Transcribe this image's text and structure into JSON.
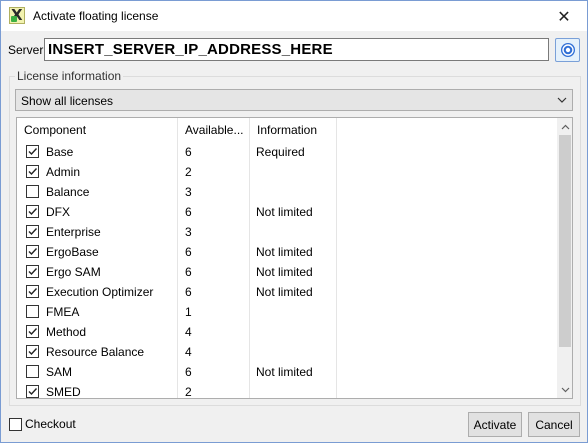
{
  "window": {
    "title": "Activate floating license",
    "close_glyph": "✕"
  },
  "server": {
    "label": "Server",
    "value": "INSERT_SERVER_IP_ADDRESS_HERE",
    "button_icon": "network-icon"
  },
  "license_info": {
    "legend": "License information",
    "filter": {
      "selected": "Show all licenses"
    },
    "table": {
      "headers": [
        "Component",
        "Available...",
        "Information"
      ],
      "rows": [
        {
          "checked": true,
          "component": "Base",
          "available": "6",
          "info": "Required"
        },
        {
          "checked": true,
          "component": "Admin",
          "available": "2",
          "info": ""
        },
        {
          "checked": false,
          "component": "Balance",
          "available": "3",
          "info": ""
        },
        {
          "checked": true,
          "component": "DFX",
          "available": "6",
          "info": "Not limited"
        },
        {
          "checked": true,
          "component": "Enterprise",
          "available": "3",
          "info": ""
        },
        {
          "checked": true,
          "component": "ErgoBase",
          "available": "6",
          "info": "Not limited"
        },
        {
          "checked": true,
          "component": "Ergo SAM",
          "available": "6",
          "info": "Not limited"
        },
        {
          "checked": true,
          "component": "Execution Optimizer",
          "available": "6",
          "info": "Not limited"
        },
        {
          "checked": false,
          "component": "FMEA",
          "available": "1",
          "info": ""
        },
        {
          "checked": true,
          "component": "Method",
          "available": "4",
          "info": ""
        },
        {
          "checked": true,
          "component": "Resource Balance",
          "available": "4",
          "info": ""
        },
        {
          "checked": false,
          "component": "SAM",
          "available": "6",
          "info": "Not limited"
        },
        {
          "checked": true,
          "component": "SMED",
          "available": "2",
          "info": ""
        }
      ]
    }
  },
  "footer": {
    "checkout": {
      "label": "Checkout",
      "checked": false
    },
    "activate_label": "Activate",
    "cancel_label": "Cancel"
  },
  "colors": {
    "window_bg": "#f0f0f0",
    "accent_border": "#7a9cd3",
    "button_bg": "#e1e1e1"
  }
}
